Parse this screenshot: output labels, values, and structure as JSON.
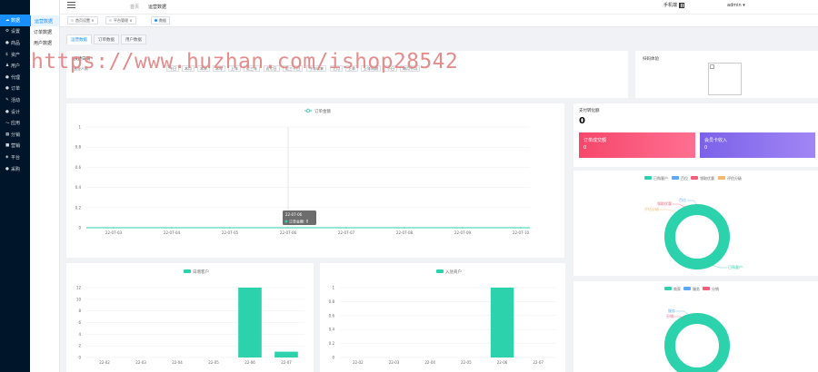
{
  "sidebar": {
    "items": [
      {
        "icon": "cloud-icon",
        "glyph": "☁",
        "label": "数据"
      },
      {
        "icon": "gear-icon",
        "glyph": "⚙",
        "label": "设置"
      },
      {
        "icon": "dot-icon",
        "glyph": "●",
        "label": "商品"
      },
      {
        "icon": "dollar-icon",
        "glyph": "$",
        "label": "资产"
      },
      {
        "icon": "user-icon",
        "glyph": "♟",
        "label": "用户"
      },
      {
        "icon": "dot-icon",
        "glyph": "●",
        "label": "代理"
      },
      {
        "icon": "dot-icon",
        "glyph": "●",
        "label": "订单"
      },
      {
        "icon": "edit-icon",
        "glyph": "✎",
        "label": "活动"
      },
      {
        "icon": "dot-icon",
        "glyph": "●",
        "label": "设计"
      },
      {
        "icon": "wave-icon",
        "glyph": "〜",
        "label": "应用"
      },
      {
        "icon": "grid-icon",
        "glyph": "▦",
        "label": "分销"
      },
      {
        "icon": "color-block-icon",
        "glyph": "■",
        "label": "营销"
      },
      {
        "icon": "stack-icon",
        "glyph": "◈",
        "label": "平台"
      },
      {
        "icon": "dot-icon",
        "glyph": "●",
        "label": "采购"
      }
    ]
  },
  "subnav": [
    "运营数据",
    "订单数据",
    "用户数据"
  ],
  "header": {
    "crumb1": "首页",
    "crumb2": "运营数据",
    "scan_label": "手机端",
    "user": "admin ▾"
  },
  "tags": [
    {
      "label": "首页设置",
      "close": "×"
    },
    {
      "label": "平台管理",
      "close": "×"
    },
    {
      "label": "数据",
      "close": ""
    }
  ],
  "tabs": [
    "运营数据",
    "订单数据",
    "用户数据"
  ],
  "filter": {
    "title": "快捷日期",
    "label": "营业人数",
    "buttons": [
      "今日",
      "本月",
      "本季",
      "本年",
      "上年",
      "近三年",
      "近七日",
      "近三十日",
      "今年以来",
      "上月",
      "上季",
      "上年同期",
      "下日",
      "每月平均"
    ]
  },
  "qr": {
    "title": "扫码体验"
  },
  "watermark": "https://www.huzhan.com/ishop28542",
  "summary": {
    "title": "支付转化额",
    "value": "0",
    "box1_label": "订单成交额",
    "box1_value": "0",
    "box2_label": "会员卡收入",
    "box2_value": "0"
  },
  "line_chart": {
    "legend": "订单金额",
    "y_ticks": [
      "1",
      "0.8",
      "0.6",
      "0.4",
      "0.2",
      "0"
    ],
    "x_ticks": [
      "22-07-03",
      "22-07-04",
      "22-07-05",
      "22-07-06",
      "22-07-07",
      "22-07-08",
      "22-07-09",
      "22-07-10"
    ],
    "tooltip_title": "22-07-06",
    "tooltip_row": "订单金额: 0",
    "color": "#2bd2ab"
  },
  "bar_chart1": {
    "legend": "日增客户",
    "y_ticks": [
      "12",
      "10",
      "8",
      "6",
      "4",
      "2",
      "0"
    ],
    "x_ticks": [
      "22-02",
      "22-03",
      "22-04",
      "22-05",
      "22-06",
      "22-07"
    ],
    "color": "#2bd2ab"
  },
  "bar_chart2": {
    "legend": "入驻商户",
    "y_ticks": [
      "1",
      "0.8",
      "0.6",
      "0.4",
      "0.2",
      "0"
    ],
    "x_ticks": [
      "22-02",
      "22-03",
      "22-04",
      "22-05",
      "22-06",
      "22-07"
    ],
    "color": "#2bd2ab"
  },
  "donut1": {
    "legend": [
      {
        "label": "已购客户",
        "color": "#2bd2ab"
      },
      {
        "label": "百位",
        "color": "#5aa9f5"
      },
      {
        "label": "领取优惠",
        "color": "#f0607e"
      },
      {
        "label": "评估分级",
        "color": "#f8b66f"
      }
    ],
    "labels": [
      "百位",
      "领取优惠",
      "评估分级",
      "已购客户"
    ]
  },
  "donut2": {
    "legend": [
      {
        "label": "商家",
        "color": "#2bd2ab"
      },
      {
        "label": "服务",
        "color": "#5aa9f5"
      },
      {
        "label": "分销",
        "color": "#f0607e"
      }
    ],
    "labels": [
      "服务",
      "分销"
    ]
  },
  "chart_data": [
    {
      "type": "line",
      "legend": [
        "订单金额"
      ],
      "x": [
        "22-07-03",
        "22-07-04",
        "22-07-05",
        "22-07-06",
        "22-07-07",
        "22-07-08",
        "22-07-09",
        "22-07-10"
      ],
      "series": [
        {
          "name": "订单金额",
          "values": [
            0,
            0,
            0,
            0,
            0,
            0,
            0,
            0
          ]
        }
      ],
      "ylim": [
        0,
        1
      ]
    },
    {
      "type": "bar",
      "legend": [
        "日增客户"
      ],
      "categories": [
        "22-02",
        "22-03",
        "22-04",
        "22-05",
        "22-06",
        "22-07"
      ],
      "series": [
        {
          "name": "日增客户",
          "values": [
            0,
            0,
            0,
            0,
            12,
            1
          ]
        }
      ],
      "ylim": [
        0,
        12
      ]
    },
    {
      "type": "bar",
      "legend": [
        "入驻商户"
      ],
      "categories": [
        "22-02",
        "22-03",
        "22-04",
        "22-05",
        "22-06",
        "22-07"
      ],
      "series": [
        {
          "name": "入驻商户",
          "values": [
            0,
            0,
            0,
            0,
            1,
            0
          ]
        }
      ],
      "ylim": [
        0,
        1
      ]
    },
    {
      "type": "pie",
      "categories": [
        "已购客户",
        "百位",
        "领取优惠",
        "评估分级"
      ],
      "values": [
        100,
        0,
        0,
        0
      ]
    },
    {
      "type": "pie",
      "categories": [
        "商家",
        "服务",
        "分销"
      ],
      "values": [
        100,
        0,
        0
      ]
    }
  ]
}
